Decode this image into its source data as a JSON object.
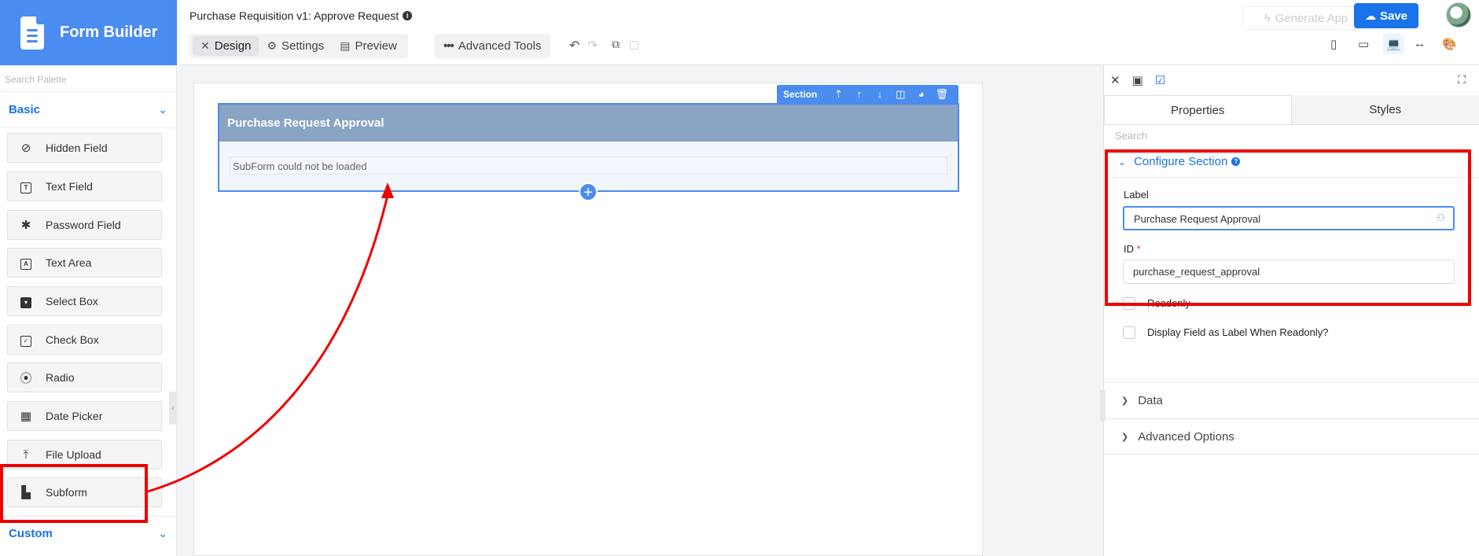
{
  "brand": {
    "title": "Form Builder",
    "icon": "document-icon"
  },
  "header": {
    "app_title": "Purchase Requisition v1: Approve Request",
    "info_icon": "i",
    "tabs": [
      {
        "label": "Design",
        "icon": "design-icon",
        "active": true
      },
      {
        "label": "Settings",
        "icon": "gear-icon",
        "active": false
      },
      {
        "label": "Preview",
        "icon": "preview-icon",
        "active": false
      }
    ],
    "advanced_tools": "Advanced Tools",
    "generate_app": "Generate App",
    "save": "Save"
  },
  "palette": {
    "search_placeholder": "Search Palette",
    "basic_group": "Basic",
    "custom_group": "Custom",
    "items": [
      {
        "label": "Hidden Field",
        "icon": "eye-slash-icon"
      },
      {
        "label": "Text Field",
        "icon": "text-field-icon"
      },
      {
        "label": "Password Field",
        "icon": "asterisk-icon"
      },
      {
        "label": "Text Area",
        "icon": "text-area-icon"
      },
      {
        "label": "Select Box",
        "icon": "select-box-icon"
      },
      {
        "label": "Check Box",
        "icon": "checkbox-icon"
      },
      {
        "label": "Radio",
        "icon": "radio-icon"
      },
      {
        "label": "Date Picker",
        "icon": "calendar-icon"
      },
      {
        "label": "File Upload",
        "icon": "upload-icon"
      },
      {
        "label": "Subform",
        "icon": "subform-icon"
      }
    ]
  },
  "canvas": {
    "section_toolbar_label": "Section",
    "section_title": "Purchase Request Approval",
    "subform_message": "SubForm could not be loaded"
  },
  "properties": {
    "tabs": [
      "Properties",
      "Styles"
    ],
    "search_placeholder": "Search",
    "configure_section": "Configure Section",
    "label_field_label": "Label",
    "label_value": "Purchase Request Approval",
    "id_field_label": "ID",
    "id_required": "*",
    "id_value": "purchase_request_approval",
    "readonly": "Readonly",
    "display_as_label": "Display Field as Label When Readonly?",
    "data_section": "Data",
    "advanced_options": "Advanced Options"
  },
  "colors": {
    "brand": "#4a8cf0",
    "primary": "#1a73e8",
    "section_header": "#8aa4c4",
    "annotation": "#ee0000"
  }
}
